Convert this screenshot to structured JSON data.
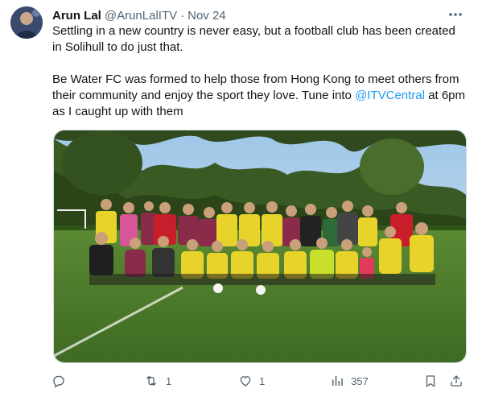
{
  "tweet": {
    "author_name": "Arun Lal",
    "handle": "@ArunLalITV",
    "separator": "·",
    "date": "Nov 24",
    "text_line_1": "Settling in a new country is never easy, but a football club has been created in Solihull to do just that.",
    "text_part_2a": "Be Water FC was formed to help those from Hong Kong to meet others from their community and enjoy the sport they love. Tune into ",
    "mention": "@ITVCentral",
    "text_part_2b": " at 6pm as I caught up with them"
  },
  "actions": {
    "reply_count": "",
    "retweet_count": "1",
    "like_count": "1",
    "views_count": "357"
  },
  "icons": {
    "more": "more-horizontal-icon",
    "reply": "reply-icon",
    "retweet": "retweet-icon",
    "like": "heart-icon",
    "views": "views-chart-icon",
    "bookmark": "bookmark-icon",
    "share": "share-icon"
  },
  "colors": {
    "text": "#0f1419",
    "secondary": "#536471",
    "link": "#1d9bf0",
    "kit_yellow": "#e8d32a",
    "kit_red": "#c81e2b",
    "grass": "#4d7a2c"
  }
}
